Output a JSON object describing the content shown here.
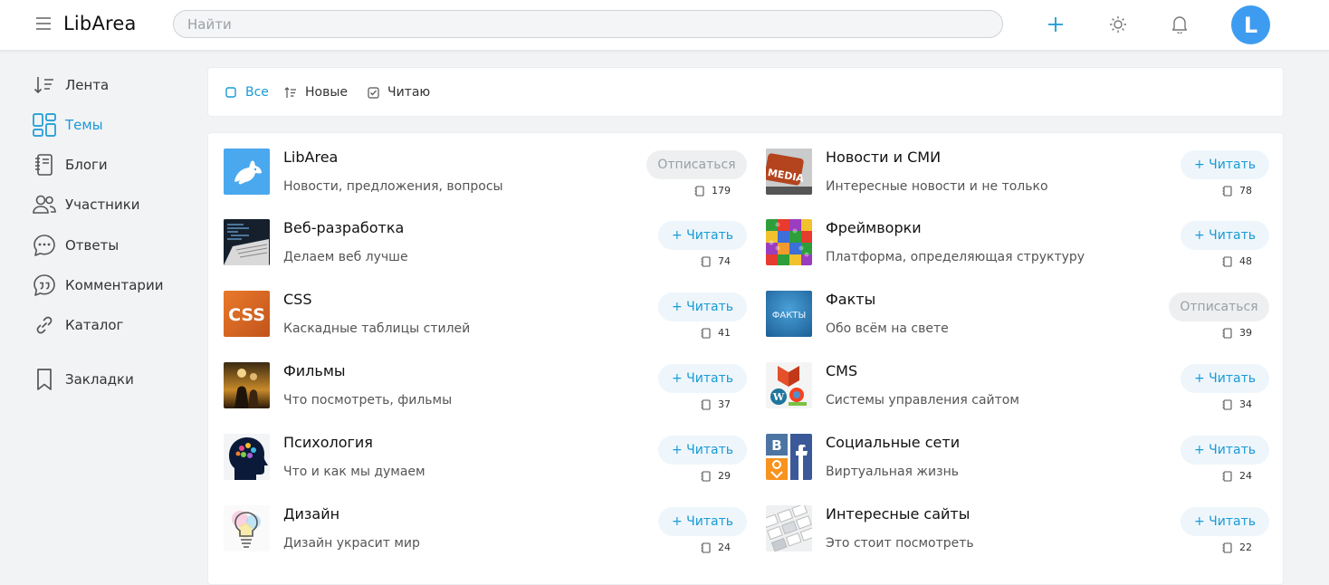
{
  "header": {
    "logo": "LibArea",
    "search_placeholder": "Найти",
    "avatar_letter": "L",
    "icons": [
      "menu-icon",
      "plus-icon",
      "sun-icon",
      "bell-icon"
    ]
  },
  "sidebar": {
    "items": [
      {
        "label": "Лента",
        "icon": "sort-feed-icon"
      },
      {
        "label": "Темы",
        "icon": "grid-icon"
      },
      {
        "label": "Блоги",
        "icon": "notebook-icon"
      },
      {
        "label": "Участники",
        "icon": "users-icon"
      },
      {
        "label": "Ответы",
        "icon": "chat-dots-icon"
      },
      {
        "label": "Комментарии",
        "icon": "quote-bubble-icon"
      },
      {
        "label": "Каталог",
        "icon": "link-icon"
      },
      {
        "label": "Закладки",
        "icon": "bookmark-icon"
      }
    ],
    "active_index": 1
  },
  "filters": [
    {
      "label": "Все",
      "icon": "square-icon"
    },
    {
      "label": "Новые",
      "icon": "sort-new-icon"
    },
    {
      "label": "Читаю",
      "icon": "checkbox-icon"
    }
  ],
  "topics": [
    {
      "title": "LibArea",
      "desc": "Новости, предложения, вопросы",
      "button": "Отписаться",
      "state": "unsub",
      "count": "179",
      "image": "libarea-logo-image"
    },
    {
      "title": "Новости и СМИ",
      "desc": "Интересные новости и не только",
      "button": "+  Читать",
      "state": "read",
      "count": "78",
      "image": "media-key-image"
    },
    {
      "title": "Веб-разработка",
      "desc": "Делаем веб лучше",
      "button": "+  Читать",
      "state": "read",
      "count": "74",
      "image": "laptop-code-image"
    },
    {
      "title": "Фреймворки",
      "desc": "Платформа, определяющая структуру",
      "button": "+  Читать",
      "state": "read",
      "count": "48",
      "image": "puzzle-image"
    },
    {
      "title": "CSS",
      "desc": "Каскадные таблицы стилей",
      "button": "+  Читать",
      "state": "read",
      "count": "41",
      "image": "css-logo-image"
    },
    {
      "title": "Факты",
      "desc": "Обо всём на свете",
      "button": "Отписаться",
      "state": "unsub",
      "count": "39",
      "image": "facts-image"
    },
    {
      "title": "Фильмы",
      "desc": "Что посмотреть, фильмы",
      "button": "+  Читать",
      "state": "read",
      "count": "37",
      "image": "movie-poster-image"
    },
    {
      "title": "CMS",
      "desc": "Системы управления сайтом",
      "button": "+  Читать",
      "state": "read",
      "count": "34",
      "image": "cms-logos-image"
    },
    {
      "title": "Психология",
      "desc": "Что и как мы думаем",
      "button": "+  Читать",
      "state": "read",
      "count": "29",
      "image": "brain-head-image"
    },
    {
      "title": "Социальные сети",
      "desc": "Виртуальная жизнь",
      "button": "+  Читать",
      "state": "read",
      "count": "24",
      "image": "social-logos-image"
    },
    {
      "title": "Дизайн",
      "desc": "Дизайн украсит мир",
      "button": "+  Читать",
      "state": "read",
      "count": "24",
      "image": "lightbulb-image"
    },
    {
      "title": "Интересные сайты",
      "desc": "Это стоит посмотреть",
      "button": "+  Читать",
      "state": "read",
      "count": "22",
      "image": "websites-image"
    }
  ],
  "colors": {
    "accent": "#1a9ad6",
    "avatar": "#3d9cf0",
    "read_bg": "#eef6fb",
    "unsub_bg": "#eeeff1"
  }
}
